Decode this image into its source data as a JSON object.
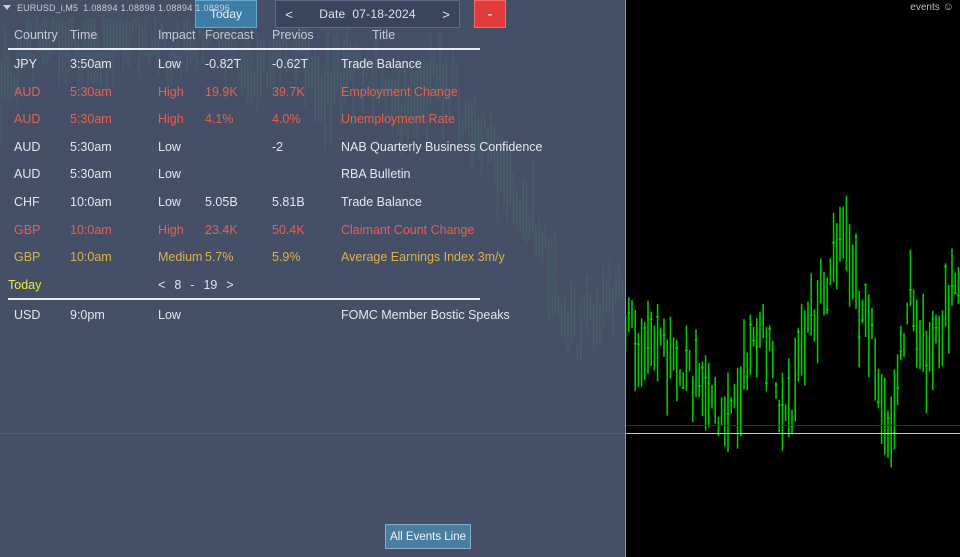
{
  "symbol_strip": {
    "dropdown_icon": "triangle-down-icon",
    "symbol": "EURUSD_i,M5",
    "ohlc": "1.08894 1.08898 1.08894 1.08896"
  },
  "events_label": {
    "text": "events",
    "icon": "smiley-face-icon",
    "glyph": "☺"
  },
  "toolbar": {
    "today_label": "Today",
    "prev_arrow": "<",
    "next_arrow": ">",
    "date_word": "Date",
    "date_value": "07-18-2024",
    "minimize_label": "-"
  },
  "columns": [
    {
      "key": "country",
      "label": "Country"
    },
    {
      "key": "time",
      "label": "Time"
    },
    {
      "key": "impact",
      "label": "Impact"
    },
    {
      "key": "forecast",
      "label": "Forecast"
    },
    {
      "key": "previous",
      "label": "Previos"
    },
    {
      "key": "title",
      "label": "Title"
    }
  ],
  "rows": [
    {
      "country": "JPY",
      "time": "3:50am",
      "impact": "Low",
      "forecast": "-0.82T",
      "previous": "-0.62T",
      "title": "Trade Balance",
      "level": "low"
    },
    {
      "country": "AUD",
      "time": "5:30am",
      "impact": "High",
      "forecast": "19.9K",
      "previous": "39.7K",
      "title": "Employment Change",
      "level": "high"
    },
    {
      "country": "AUD",
      "time": "5:30am",
      "impact": "High",
      "forecast": "4.1%",
      "previous": "4.0%",
      "title": "Unemployment Rate",
      "level": "high"
    },
    {
      "country": "AUD",
      "time": "5:30am",
      "impact": "Low",
      "forecast": "",
      "previous": "-2",
      "title": "NAB Quarterly Business Confidence",
      "level": "low"
    },
    {
      "country": "AUD",
      "time": "5:30am",
      "impact": "Low",
      "forecast": "",
      "previous": "",
      "title": "RBA Bulletin",
      "level": "low"
    },
    {
      "country": "CHF",
      "time": "10:0am",
      "impact": "Low",
      "forecast": "5.05B",
      "previous": "5.81B",
      "title": "Trade Balance",
      "level": "low"
    },
    {
      "country": "GBP",
      "time": "10:0am",
      "impact": "High",
      "forecast": "23.4K",
      "previous": "50.4K",
      "title": "Claimant Count Change",
      "level": "high"
    },
    {
      "country": "GBP",
      "time": "10:0am",
      "impact": "Medium",
      "forecast": "5.7%",
      "previous": "5.9%",
      "title": "Average Earnings Index 3m/y",
      "level": "medium"
    }
  ],
  "today_separator": {
    "label": "Today",
    "prev_arrow": "<",
    "page_current": "8",
    "page_dash": "-",
    "page_total": "19",
    "next_arrow": ">"
  },
  "today_rows": [
    {
      "country": "USD",
      "time": "9:0pm",
      "impact": "Low",
      "forecast": "",
      "previous": "",
      "title": "FOMC Member Bostic Speaks",
      "level": "low"
    }
  ],
  "footer": {
    "all_events_label": "All Events Line"
  },
  "colors": {
    "panel_bg": "#4a5570",
    "panel_border": "#8b94a8",
    "today_button": "#3d7ea6",
    "minimize_button": "#e23b3b",
    "impact_low": "#e3e7ee",
    "impact_medium": "#d9b44a",
    "impact_high": "#e8604f",
    "today_text": "#ece93c",
    "chart_bg": "#000000",
    "candle_up": "#00c800",
    "price_line_red": "#7a1010",
    "price_line_white": "#c9c9c9"
  }
}
